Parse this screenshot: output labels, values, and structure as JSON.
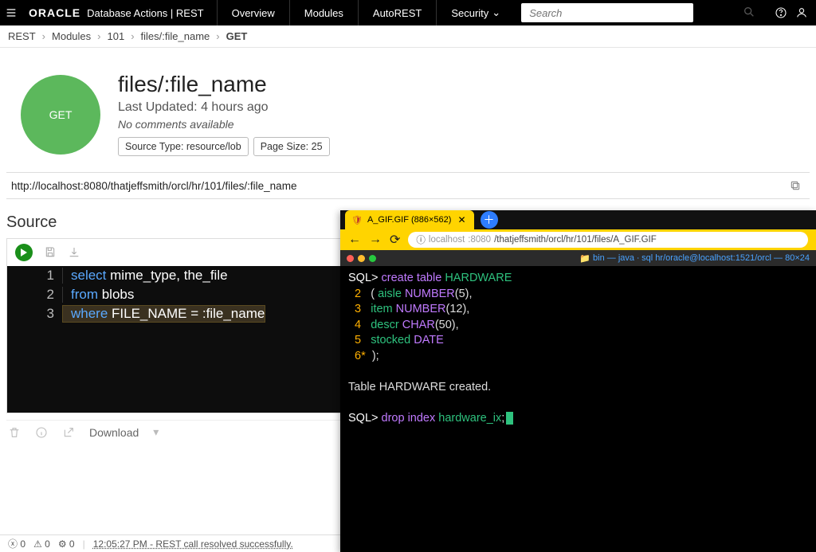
{
  "topbar": {
    "brand": "ORACLE",
    "product": "Database Actions | REST",
    "tabs": [
      "Overview",
      "Modules",
      "AutoREST",
      "Security"
    ],
    "search_placeholder": "Search"
  },
  "breadcrumb": [
    "REST",
    "Modules",
    "101",
    "files/:file_name",
    "GET"
  ],
  "header": {
    "method": "GET",
    "title": "files/:file_name",
    "updated": "Last Updated: 4 hours ago",
    "comments": "No comments available",
    "pill_source": "Source Type: resource/lob",
    "pill_page": "Page Size: 25",
    "url": "http://localhost:8080/thatjeffsmith/orcl/hr/101/files/:file_name"
  },
  "source": {
    "title": "Source",
    "lines": [
      {
        "n": "1",
        "k": "select",
        "rest": " mime_type, the_file"
      },
      {
        "n": "2",
        "k": "from",
        "rest": " blobs"
      },
      {
        "n": "3",
        "k": "where",
        "rest": " FILE_NAME = :file_name"
      }
    ],
    "download": "Download"
  },
  "status": {
    "err": "0",
    "warn": "0",
    "gear": "0",
    "msg": "12:05:27 PM - REST call resolved successfully."
  },
  "overlay": {
    "tab_title": "A_GIF.GIF (886×562)",
    "addr_info": "ⓘ",
    "addr_host": "localhost",
    "addr_port": ":8080",
    "addr_path": "/thatjeffsmith/orcl/hr/101/files/A_GIF.GIF",
    "term_title": "bin — java ∙ sql hr/oracle@localhost:1521/orcl — 80×24",
    "term": {
      "l1_prompt": "SQL> ",
      "l1_kw": "create table ",
      "l1_id": "HARDWARE",
      "l2_n": "  2   ",
      "l2_p": "( ",
      "l2_a": "aisle ",
      "l2_t": "NUMBER",
      "l2_r": "(5),",
      "l3_n": "  3   ",
      "l3_a": "item ",
      "l3_t": "NUMBER",
      "l3_r": "(12),",
      "l4_n": "  4   ",
      "l4_a": "descr ",
      "l4_t": "CHAR",
      "l4_r": "(50),",
      "l5_n": "  5   ",
      "l5_a": "stocked ",
      "l5_t": "DATE",
      "l6_n": "  6*  ",
      "l6_r": ");",
      "blank": "",
      "l7": "Table HARDWARE created.",
      "l8_prompt": "SQL> ",
      "l8_kw": "drop index ",
      "l8_id": "hardware_ix",
      "l8_semi": ";"
    }
  }
}
